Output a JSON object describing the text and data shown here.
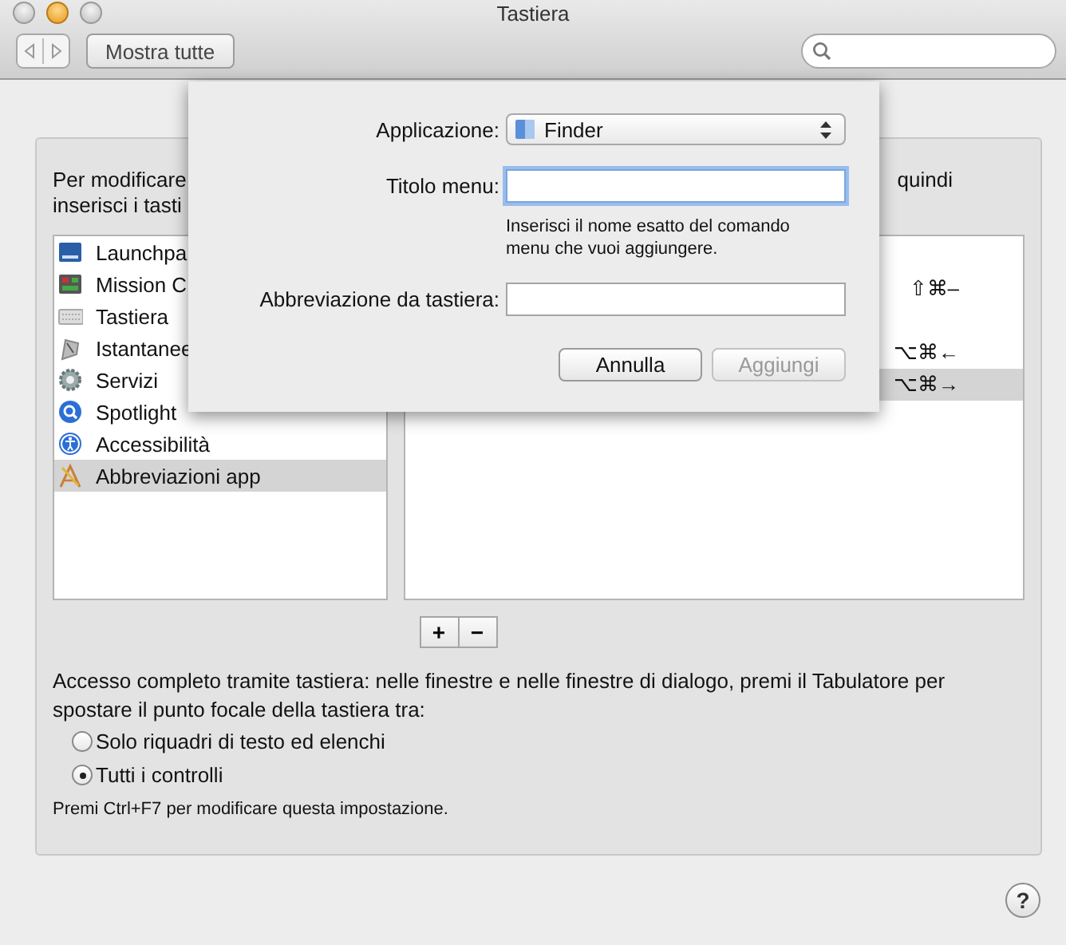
{
  "window": {
    "title": "Tastiera"
  },
  "toolbar": {
    "show_all": "Mostra tutte"
  },
  "panel": {
    "intro_line1": [
      "Per modificare",
      "quindi"
    ],
    "intro_line2": "inserisci i tasti",
    "categories": [
      {
        "label": "Launchpa",
        "selected": false
      },
      {
        "label": "Mission C",
        "selected": false
      },
      {
        "label": "Tastiera",
        "selected": false
      },
      {
        "label": "Istantanee",
        "selected": false
      },
      {
        "label": "Servizi",
        "selected": false
      },
      {
        "label": "Spotlight",
        "selected": false
      },
      {
        "label": "Accessibilità",
        "selected": false
      },
      {
        "label": "Abbreviazioni app",
        "selected": true
      }
    ],
    "shortcuts": [
      {
        "keys": "⇧⌘–",
        "selected": false
      },
      {
        "keys": "⌥⌘←",
        "selected": false
      },
      {
        "keys": "⌥⌘→",
        "selected": true
      }
    ],
    "add_button": "+",
    "remove_button": "−",
    "access_text": "Accesso completo tramite tastiera: nelle finestre e nelle finestre di dialogo, premi il Tabulatore per spostare il punto focale della tastiera tra:",
    "options": [
      {
        "label": "Solo riquadri di testo ed elenchi",
        "selected": false
      },
      {
        "label": "Tutti i controlli",
        "selected": true
      }
    ],
    "note": "Premi Ctrl+F7 per modificare questa impostazione."
  },
  "help": "?",
  "sheet": {
    "application": {
      "label": "Applicazione:",
      "value": "Finder"
    },
    "menu_title": {
      "label": "Titolo menu:",
      "focused": true
    },
    "hint": "Inserisci il nome esatto del comando menu che vuoi aggiungere.",
    "shortcut_field": {
      "label": "Abbreviazione da tastiera:",
      "focused": false
    },
    "buttons": [
      {
        "label": "Annulla",
        "disabled": false
      },
      {
        "label": "Aggiungi",
        "disabled": true
      }
    ]
  }
}
